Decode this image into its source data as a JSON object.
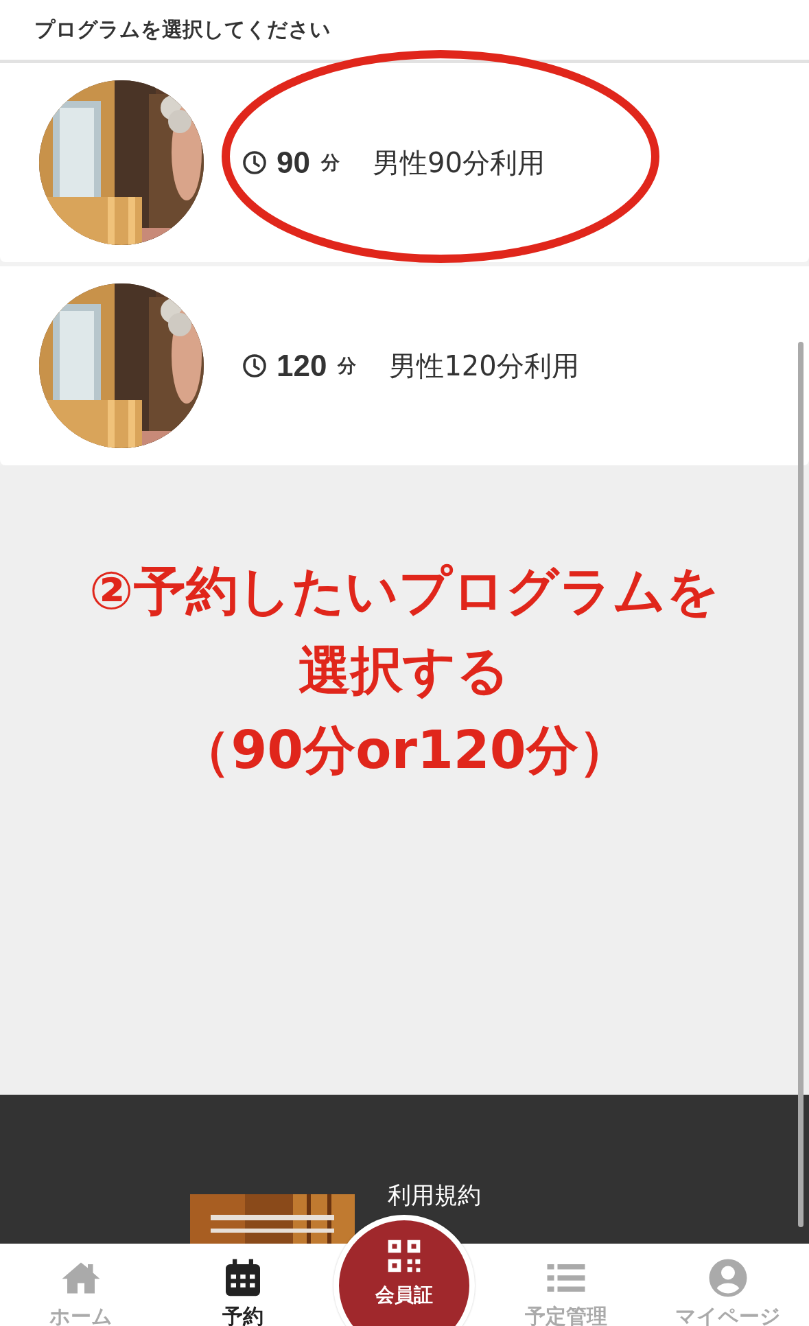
{
  "header": {
    "title": "プログラムを選択してください"
  },
  "programs": [
    {
      "duration": "90",
      "unit": "分",
      "name": "男性90分利用",
      "circled": true
    },
    {
      "duration": "120",
      "unit": "分",
      "name": "男性120分利用",
      "circled": false
    }
  ],
  "annotation": {
    "lines": [
      "②予約したいプログラムを",
      "選択する",
      "（90分or120分）"
    ]
  },
  "footer": {
    "link": "利用規約"
  },
  "nav": [
    {
      "kind": "home",
      "label": "ホーム",
      "selected": false
    },
    {
      "kind": "calendar",
      "label": "予約",
      "selected": true
    },
    {
      "kind": "qr",
      "label": "会員証",
      "selected": false
    },
    {
      "kind": "list",
      "label": "予定管理",
      "selected": false
    },
    {
      "kind": "user",
      "label": "マイページ",
      "selected": false
    }
  ]
}
